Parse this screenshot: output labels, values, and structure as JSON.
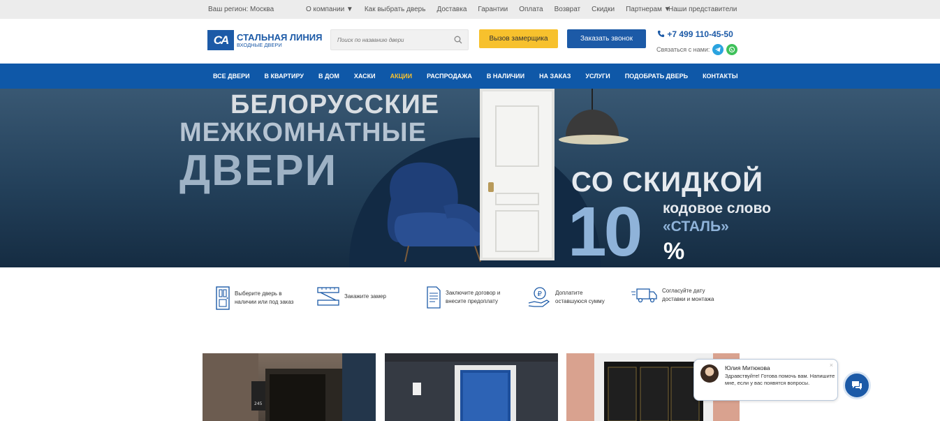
{
  "topbar": {
    "region": "Ваш регион: Москва",
    "links": [
      "О компании ▼",
      "Как выбрать дверь",
      "Доставка",
      "Гарантии",
      "Оплата",
      "Возврат",
      "Скидки",
      "Партнерам ▼"
    ],
    "representatives": "Наши представители"
  },
  "header": {
    "logo_mark": "CA",
    "logo_title": "СТАЛЬНАЯ ЛИНИЯ",
    "logo_subtitle": "ВХОДНЫЕ ДВЕРИ",
    "search_placeholder": "Поиск по названию двери",
    "measurer_button": "Вызов замерщика",
    "callback_button": "Заказать звонок",
    "phone": "+7 499 110-45-50",
    "contact_label": "Связаться с нами:"
  },
  "nav": {
    "items": [
      "ВСЕ ДВЕРИ",
      "В КВАРТИРУ",
      "В ДОМ",
      "ХАСКИ",
      "АКЦИИ",
      "РАСПРОДАЖА",
      "В НАЛИЧИИ",
      "НА ЗАКАЗ",
      "УСЛУГИ",
      "ПОДОБРАТЬ ДВЕРЬ",
      "КОНТАКТЫ"
    ],
    "active": "АКЦИИ"
  },
  "hero": {
    "line1": "БЕЛОРУССКИЕ",
    "line2": "МЕЖКОМНАТНЫЕ",
    "line3": "ДВЕРИ",
    "sale": "СО СКИДКОЙ",
    "discount": "10",
    "code_label": "кодовое слово",
    "code_word": "«СТАЛЬ»",
    "percent": "%"
  },
  "steps": [
    {
      "icon": "door-icon",
      "text": "Выберите дверь в\nналичии или под заказ"
    },
    {
      "icon": "ruler-icon",
      "text": "Закажите замер"
    },
    {
      "icon": "contract-icon",
      "text": "Заключите договор и\nвнесите предоплату"
    },
    {
      "icon": "payment-icon",
      "text": "Доплатите\nоставшуюся сумму"
    },
    {
      "icon": "delivery-truck-icon",
      "text": "Согласуйте дату\nдоставки и монтажа"
    }
  ],
  "cards": {
    "card1_number": "245"
  },
  "chat": {
    "name": "Юлия Митюкова",
    "message": "Здравствуйте! Готова помочь вам. Напишите мне, если у вас появятся вопросы.",
    "close": "×"
  },
  "colors": {
    "brand_blue": "#1c5aa7",
    "nav_blue": "#0f58a8",
    "accent_yellow": "#f7c12d"
  }
}
